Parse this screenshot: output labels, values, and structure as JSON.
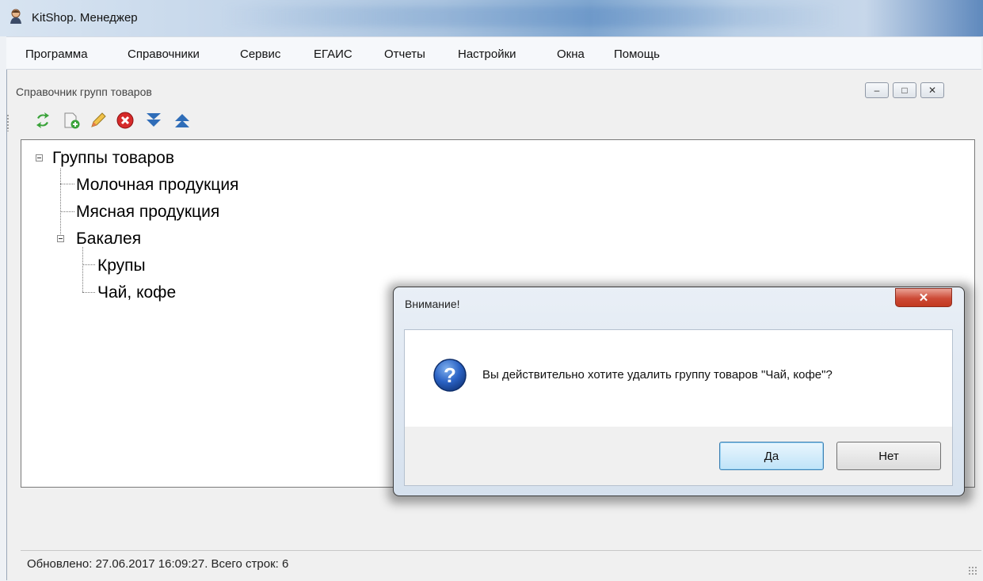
{
  "app": {
    "title": "KitShop. Менеджер"
  },
  "menu": [
    "Программа",
    "Справочники",
    "Сервис",
    "ЕГАИС",
    "Отчеты",
    "Настройки",
    "Окна",
    "Помощь"
  ],
  "child_window": {
    "title": "Справочник групп товаров"
  },
  "toolbar": {
    "icons": [
      "refresh-icon",
      "add-document-icon",
      "edit-pencil-icon",
      "delete-icon",
      "move-down-icon",
      "move-up-icon"
    ]
  },
  "tree": {
    "root": "Группы товаров",
    "items": [
      "Молочная продукция",
      "Мясная продукция",
      "Бакалея"
    ],
    "bakaleya_children": [
      "Крупы",
      "Чай, кофе"
    ]
  },
  "status": {
    "text": "Обновлено: 27.06.2017 16:09:27. Всего строк: 6"
  },
  "dialog": {
    "title": "Внимание!",
    "message": "Вы действительно хотите удалить группу товаров \"Чай, кофе\"?",
    "yes": "Да",
    "no": "Нет"
  },
  "colors": {
    "close_red": "#cc4a36",
    "accent_blue": "#2f6db8",
    "default_button_border": "#3c7fb1"
  }
}
